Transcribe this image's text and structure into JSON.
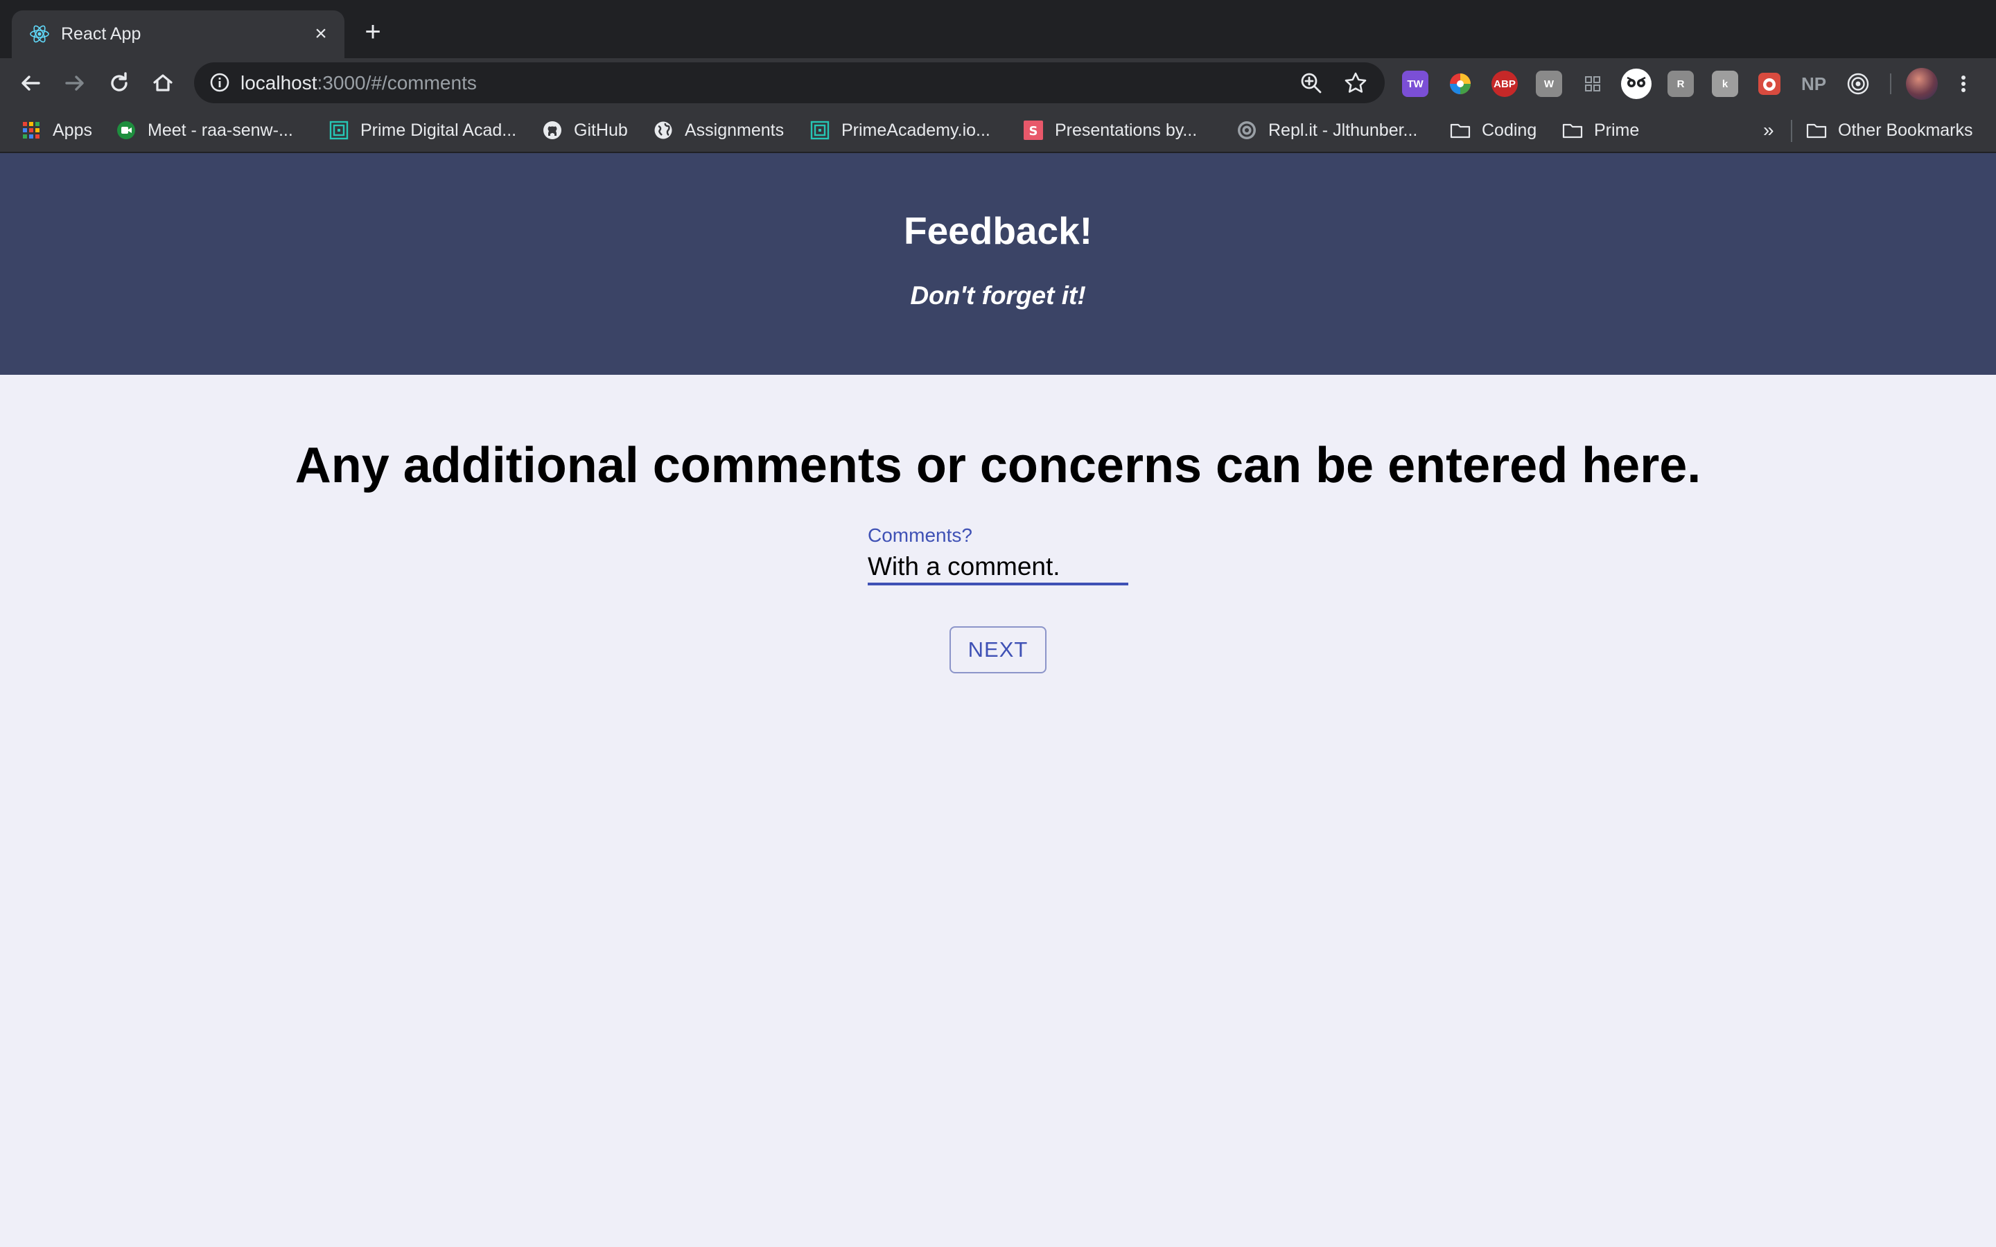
{
  "browser": {
    "tab": {
      "title": "React App",
      "favicon": "react-logo-icon"
    },
    "address_bar": {
      "host": "localhost",
      "rest": ":3000/#/comments"
    },
    "extensions": [
      {
        "name": "tw-extension-icon",
        "label": "TW",
        "color": "#7b4fd6"
      },
      {
        "name": "color-wheel-extension-icon",
        "label": "",
        "color": "#e8eaed"
      },
      {
        "name": "adblock-plus-icon",
        "label": "ABP",
        "color": "#c62828"
      },
      {
        "name": "w-extension-icon",
        "label": "W",
        "color": "#8a8a8a"
      },
      {
        "name": "grid-extension-icon",
        "label": "",
        "color": "#35363a"
      },
      {
        "name": "owl-extension-icon",
        "label": "",
        "color": "#ffffff"
      },
      {
        "name": "r-extension-icon",
        "label": "R",
        "color": "#8a8a8a"
      },
      {
        "name": "k-extension-icon",
        "label": "k",
        "color": "#9e9e9e"
      },
      {
        "name": "red-extension-icon",
        "label": "",
        "color": "#d84b3f"
      },
      {
        "name": "np-extension-icon",
        "label": "NP",
        "color": "#35363a"
      },
      {
        "name": "target-extension-icon",
        "label": "",
        "color": "#35363a"
      }
    ],
    "bookmarks": [
      {
        "label": "Apps",
        "icon": "apps-grid-icon"
      },
      {
        "label": "Meet - raa-senw-...",
        "icon": "google-meet-icon"
      },
      {
        "label": "Prime Digital Acad...",
        "icon": "prime-academy-icon"
      },
      {
        "label": "GitHub",
        "icon": "github-icon"
      },
      {
        "label": "Assignments",
        "icon": "globe-icon"
      },
      {
        "label": "PrimeAcademy.io...",
        "icon": "prime-academy-icon"
      },
      {
        "label": "Presentations by...",
        "icon": "slides-icon"
      },
      {
        "label": "Repl.it - Jlthunber...",
        "icon": "replit-icon"
      },
      {
        "label": "Coding",
        "icon": "folder-icon"
      },
      {
        "label": "Prime",
        "icon": "folder-icon"
      }
    ],
    "overflow_label": "»",
    "other_bookmarks": "Other Bookmarks"
  },
  "app": {
    "title": "Feedback!",
    "subtitle": "Don't forget it!"
  },
  "page": {
    "question": "Any additional comments or concerns can be entered here.",
    "field": {
      "label": "Comments?",
      "value": "With a comment."
    },
    "next_label": "NEXT"
  },
  "colors": {
    "header_bg": "#3b4466",
    "page_bg": "#efeff8",
    "accent": "#3f51b5"
  }
}
